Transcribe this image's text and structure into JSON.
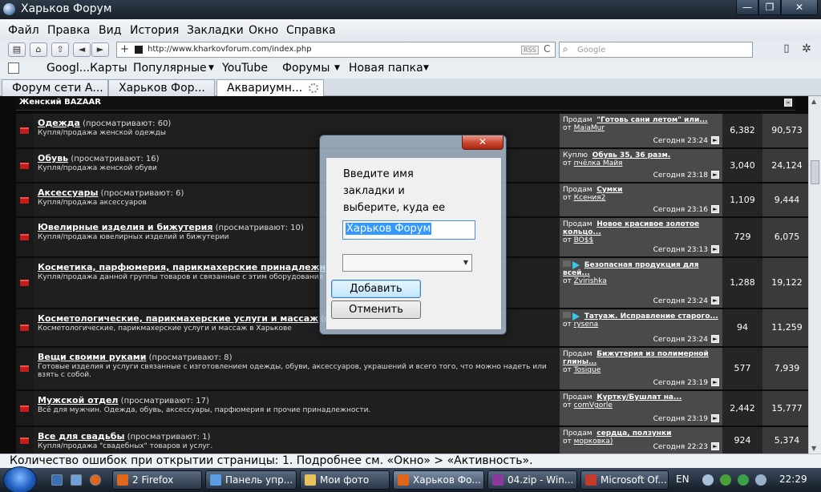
{
  "window": {
    "title": "Харьков Форум",
    "min": "—",
    "max": "❐",
    "close": "✕"
  },
  "menu": [
    "Файл",
    "Правка",
    "Вид",
    "История",
    "Закладки",
    "Окно",
    "Справка"
  ],
  "nav": {
    "back": "◄",
    "forward": "►",
    "plus": "+",
    "url": "http://www.kharkovforum.com/index.php",
    "rss": "RSS",
    "reload": "C",
    "search_placeholder": "Google",
    "page_icon": "▯",
    "gear": "✲"
  },
  "bookmarks": [
    {
      "label": "Googl...Карты",
      "dropdown": false
    },
    {
      "label": "Популярные",
      "dropdown": true
    },
    {
      "label": "YouTube",
      "dropdown": false
    },
    {
      "label": "Форумы",
      "dropdown": true
    },
    {
      "label": "Новая папка",
      "dropdown": true
    }
  ],
  "tabs": [
    "Форум сети А...",
    "Харьков Фор...",
    "Аквариумн..."
  ],
  "section": {
    "title": "Женский BAZAAR"
  },
  "forums": [
    {
      "name": "Одежда",
      "watching": "(просматривают: 60)",
      "desc": "Купля/продажа женской одежды",
      "prefix": "Продам",
      "last_title": "\"Готовь сани летом\" или...",
      "by": "от",
      "author": "MaiaMur",
      "date": "Сегодня 23:24",
      "topics": "6,382",
      "posts": "90,573"
    },
    {
      "name": "Обувь",
      "watching": "(просматривают: 16)",
      "desc": "Купля/продажа женской обуви",
      "prefix": "Куплю",
      "last_title": "Обувь 35, 36 разм.",
      "by": "от",
      "author": "пчёлка Майя",
      "date": "Сегодня 23:18",
      "topics": "3,040",
      "posts": "24,124"
    },
    {
      "name": "Аксессуары",
      "watching": "(просматривают: 6)",
      "desc": "Купля/продажа аксессуаров",
      "prefix": "Продам",
      "last_title": "Сумки",
      "by": "от",
      "author": "Ксения2",
      "date": "Сегодня 23:16",
      "topics": "1,109",
      "posts": "9,444"
    },
    {
      "name": "Ювелирные изделия и бижутерия",
      "watching": "(просматривают: 10)",
      "desc": "Купля/продажа ювелирных изделий и бижутерии",
      "prefix": "Продам",
      "last_title": "Новое красивое золотое кольцо...",
      "by": "от",
      "author": "BO$$",
      "date": "Сегодня 23:13",
      "topics": "729",
      "posts": "6,075"
    },
    {
      "name": "Косметика, парфюмерия, парикмахерские принадлежност",
      "watching": "",
      "desc": "Купля/продажа данной группы товаров и связанные с этим оборудование",
      "prefix": "",
      "last_title": "Безопасная продукция для всей...",
      "by": "от",
      "author": "Zvirishka",
      "date": "Сегодня 23:24",
      "topics": "1,288",
      "posts": "19,122"
    },
    {
      "name": "Косметологические, парикмахерские услуги и массаж",
      "watching": "(пр",
      "desc": "Косметологические, парикмахерские услуги и массаж в Харькове",
      "prefix": "",
      "last_title": "Татуаж. Исправление старого...",
      "by": "от",
      "author": "rysena",
      "date": "Сегодня 23:24",
      "topics": "94",
      "posts": "11,259"
    },
    {
      "name": "Вещи своими руками",
      "watching": "(просматривают: 8)",
      "desc": "Готовые изделия и услуги связанные с изготовлением одежды, обуви, аксессуаров, украшений и всего того, что можно надеть или взять с собой.",
      "prefix": "Продам",
      "last_title": "Бижутерия из полимерной глины...",
      "by": "от",
      "author": "Tosique",
      "date": "Сегодня 23:19",
      "topics": "577",
      "posts": "7,939"
    },
    {
      "name": "Мужской отдел",
      "watching": "(просматривают: 17)",
      "desc": "Всё для мужчин. Одежда, обувь, аксессуары, парфюмерия и прочие принадлежности.",
      "prefix": "Продам",
      "last_title": "Куртку/Бушлат на...",
      "by": "от",
      "author": "comVgorle",
      "date": "Сегодня 23:19",
      "topics": "2,442",
      "posts": "15,777"
    },
    {
      "name": "Все для свадьбы",
      "watching": "(просматривают: 1)",
      "desc": "Купля/продажа \"свадебных\" товаров и услуг.",
      "prefix": "Продам",
      "last_title": "сердца, ползунки",
      "by": "от",
      "author": "морковка)",
      "date": "Сегодня 22:23",
      "topics": "924",
      "posts": "5,374"
    }
  ],
  "status": "Количество ошибок при открытии страницы: 1. Подробнее см. «Окно» > «Активность».",
  "dialog": {
    "close": "✕",
    "prompt": "Введите имя закладки и выберите, куда ее поместить.",
    "name_value": "Харьков Форум",
    "select_chevron": "▼",
    "add_label": "Добавить",
    "cancel_label": "Отменить"
  },
  "taskbar": {
    "tasks": [
      {
        "label": "2 Firefox",
        "color": "#e0661c"
      },
      {
        "label": "Панель упр...",
        "color": "#5a9de0"
      },
      {
        "label": "Мои фото",
        "color": "#e8c25a"
      },
      {
        "label": "Харьков Фо...",
        "color": "#e0661c"
      },
      {
        "label": "04.zip - Win...",
        "color": "#8a3a9a"
      },
      {
        "label": "Microsoft Of...",
        "color": "#c43b2a"
      }
    ],
    "lang": "EN",
    "time": "22:29"
  }
}
